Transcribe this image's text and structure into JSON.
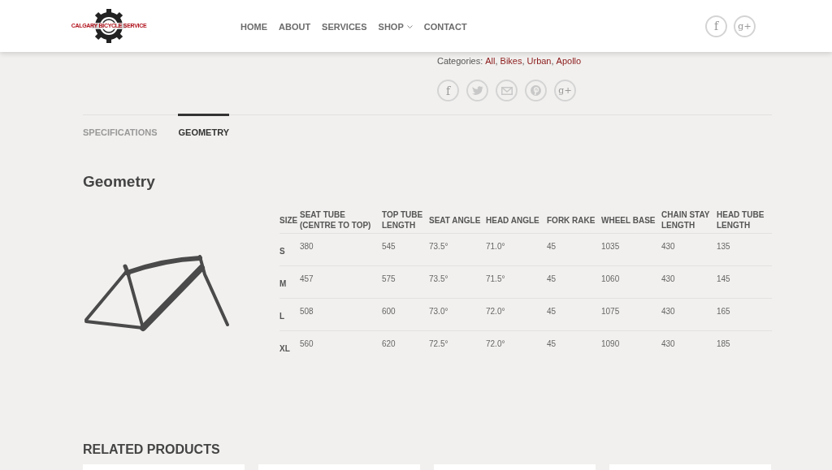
{
  "header": {
    "logo_text": "CALGARY BICYCLE SERVICE",
    "nav": [
      {
        "label": "HOME",
        "dropdown": false
      },
      {
        "label": "ABOUT",
        "dropdown": false
      },
      {
        "label": "SERVICES",
        "dropdown": false
      },
      {
        "label": "SHOP",
        "dropdown": true
      },
      {
        "label": "CONTACT",
        "dropdown": false
      }
    ],
    "social": [
      {
        "kind": "facebook",
        "glyph": "f"
      },
      {
        "kind": "googleplus",
        "glyph": "g+"
      }
    ]
  },
  "product": {
    "categories_label": "Categories:",
    "categories": [
      "All",
      "Bikes",
      "Urban",
      "Apollo"
    ],
    "separator": ",",
    "share": [
      {
        "kind": "facebook",
        "glyph": "f"
      },
      {
        "kind": "twitter"
      },
      {
        "kind": "email"
      },
      {
        "kind": "pinterest"
      },
      {
        "kind": "googleplus",
        "glyph": "g+"
      }
    ]
  },
  "tabs": [
    {
      "label": "SPECIFICATIONS",
      "selected": false
    },
    {
      "label": "GEOMETRY",
      "selected": true
    }
  ],
  "geometry": {
    "title": "Geometry",
    "columns": [
      "SIZE",
      "SEAT TUBE (CENTRE TO TOP)",
      "TOP TUBE LENGTH",
      "SEAT ANGLE",
      "HEAD ANGLE",
      "FORK RAKE",
      "WHEEL BASE",
      "CHAIN STAY LENGTH",
      "HEAD TUBE LENGTH"
    ],
    "rows": [
      [
        "S",
        "380",
        "545",
        "73.5°",
        "71.0°",
        "45",
        "1035",
        "430",
        "135"
      ],
      [
        "M",
        "457",
        "575",
        "73.5°",
        "71.5°",
        "45",
        "1060",
        "430",
        "145"
      ],
      [
        "L",
        "508",
        "600",
        "73.0°",
        "72.0°",
        "45",
        "1075",
        "430",
        "165"
      ],
      [
        "XL",
        "560",
        "620",
        "72.5°",
        "72.0°",
        "45",
        "1090",
        "430",
        "185"
      ]
    ]
  },
  "related": {
    "title": "RELATED PRODUCTS"
  }
}
